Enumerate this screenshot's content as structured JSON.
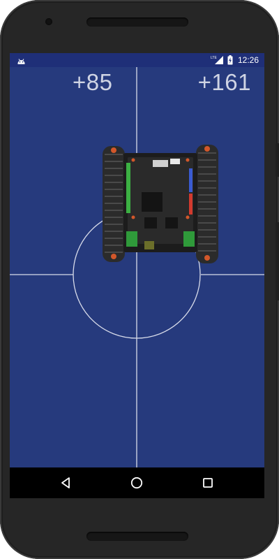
{
  "status_bar": {
    "app_icon": "android-icon",
    "network_label": "LTE",
    "signal_icon": "cell-signal-icon",
    "battery_icon": "battery-charging-icon",
    "time": "12:26"
  },
  "joystick": {
    "left_value": "+85",
    "right_value": "+161",
    "robot_image": "tracked-robot-chassis"
  },
  "nav_bar": {
    "back_icon": "back-triangle-icon",
    "home_icon": "home-circle-icon",
    "recents_icon": "recents-square-icon"
  },
  "colors": {
    "screen_bg": "#263a7d",
    "status_bar_bg": "#1f2f78",
    "grid_line": "#d8dcea",
    "value_text": "#cfd4e4",
    "phone_body": "#262626",
    "nav_bar_bg": "#000000"
  }
}
